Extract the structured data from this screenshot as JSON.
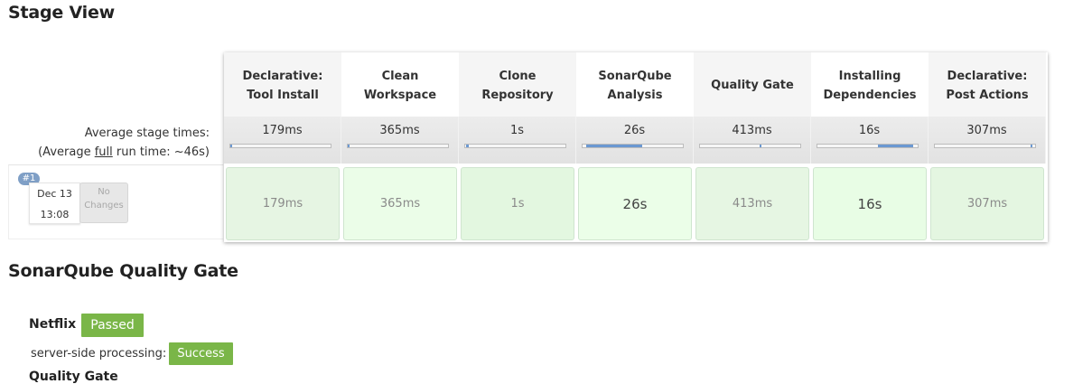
{
  "titles": {
    "stage_view": "Stage View",
    "sonar": "SonarQube Quality Gate"
  },
  "stages": [
    {
      "line1": "Declarative:",
      "line2": "Tool Install",
      "avg": "179ms",
      "run": "179ms"
    },
    {
      "line1": "Clean",
      "line2": "Workspace",
      "avg": "365ms",
      "run": "365ms"
    },
    {
      "line1": "Clone",
      "line2": "Repository",
      "avg": "1s",
      "run": "1s"
    },
    {
      "line1": "SonarQube",
      "line2": "Analysis",
      "avg": "26s",
      "run": "26s"
    },
    {
      "line1": "Quality Gate",
      "line2": "",
      "avg": "413ms",
      "run": "413ms"
    },
    {
      "line1": "Installing",
      "line2": "Dependencies",
      "avg": "16s",
      "run": "16s"
    },
    {
      "line1": "Declarative:",
      "line2": "Post Actions",
      "avg": "307ms",
      "run": "307ms"
    }
  ],
  "stage_progress_fraction": [
    0.0039,
    0.0079,
    0.0217,
    0.5652,
    0.009,
    0.3478,
    0.0067
  ],
  "avg_labels": {
    "line1": "Average stage times:",
    "line2_pre": "(Average ",
    "line2_link": "full",
    "line2_post": " run time: ~46s)"
  },
  "build": {
    "number": "#1",
    "date": "Dec 13",
    "time": "13:08",
    "changes_line1": "No",
    "changes_line2": "Changes"
  },
  "quality_gate": {
    "project": "Netflix",
    "status": "Passed",
    "processing_label": "server-side processing:",
    "processing_status": "Success",
    "status_color": "#7ab648"
  },
  "cut_off_text": "Quality Gate"
}
